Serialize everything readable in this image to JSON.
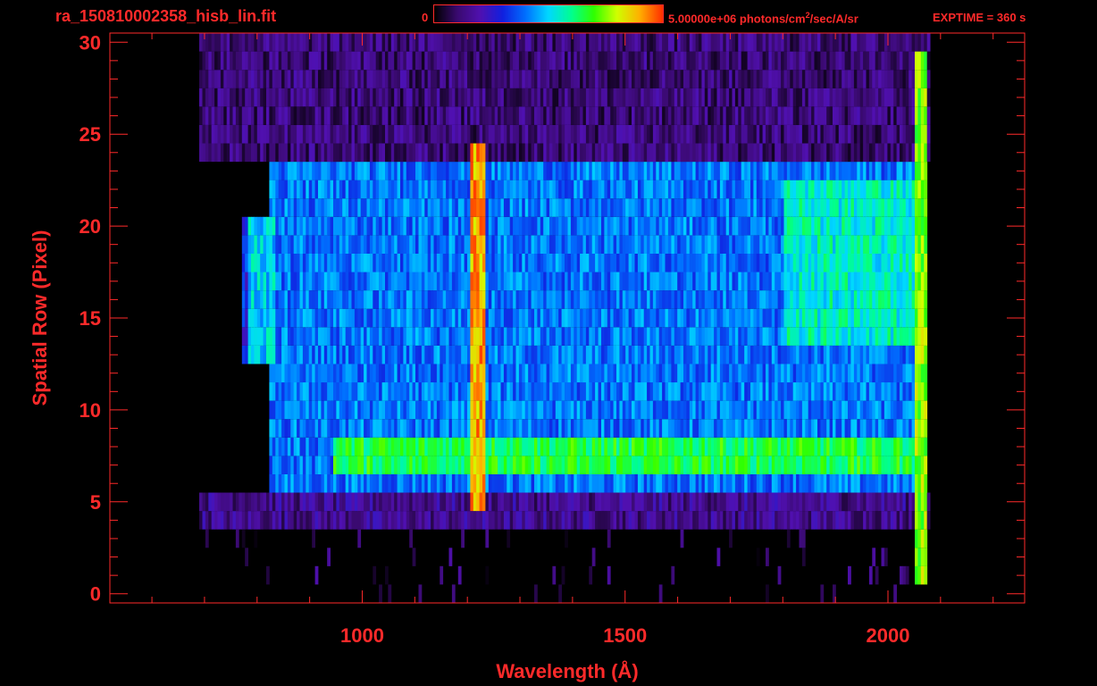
{
  "header": {
    "file_name": "ra_150810002358_hisb_lin.fit",
    "colorbar_min": "0",
    "colorbar_max_value": "5.00000e+06",
    "colorbar_unit_prefix": "photons/cm",
    "colorbar_unit_exp": "2",
    "colorbar_unit_suffix": "/sec/A/sr",
    "exptime": "EXPTIME = 360 s"
  },
  "colors": {
    "axis": "#ff2a2a",
    "background": "#000000",
    "colormap": [
      "#000000",
      "#3a0a70",
      "#5010b0",
      "#1020e0",
      "#0070ff",
      "#00d8ff",
      "#00ff90",
      "#30ff00",
      "#d0ff00",
      "#ffb000",
      "#ff3000"
    ]
  },
  "chart_data": {
    "type": "heatmap",
    "title": "ra_150810002358_hisb_lin.fit",
    "xlabel": "Wavelength (Å)",
    "ylabel": "Spatial Row (Pixel)",
    "x_ticks": [
      "1000",
      "1500",
      "2000"
    ],
    "y_ticks": [
      "0",
      "5",
      "10",
      "15",
      "20",
      "25",
      "30"
    ],
    "xlim": [
      520,
      2260
    ],
    "ylim": [
      -0.5,
      30.5
    ],
    "grid": false,
    "colorbar": {
      "min": 0,
      "max": 5000000,
      "units": "photons/cm^2/sec/A/sr"
    },
    "wavelength_coverage": [
      690,
      2080
    ],
    "features": [
      {
        "name": "Lyman-alpha emission line",
        "wavelength": 1216,
        "rows": [
          5,
          24
        ],
        "intensity": 0.9
      },
      {
        "name": "slit-edge bright band",
        "wavelength_range": [
          940,
          2060
        ],
        "rows": [
          7,
          8
        ],
        "intensity": 0.65
      },
      {
        "name": "long-wavelength band",
        "wavelength_range": [
          1800,
          2060
        ],
        "rows": [
          14,
          22
        ],
        "intensity": 0.55
      },
      {
        "name": "short-wavelength loop",
        "wavelength_range": [
          780,
          830
        ],
        "rows": [
          13,
          20
        ],
        "intensity": 0.5
      },
      {
        "name": "edge spike",
        "wavelength": 2060,
        "rows": [
          1,
          29
        ],
        "intensity": 0.75
      }
    ],
    "illuminated_rows": [
      {
        "rows": [
          6,
          23
        ],
        "wavelength_range": [
          820,
          2060
        ],
        "intensity": 0.4
      },
      {
        "rows": [
          13,
          20
        ],
        "wavelength_range": [
          770,
          820
        ],
        "intensity": 0.3
      },
      {
        "rows": [
          24,
          30
        ],
        "wavelength_range": [
          690,
          2080
        ],
        "intensity": 0.12
      },
      {
        "rows": [
          4,
          5
        ],
        "wavelength_range": [
          690,
          2080
        ],
        "intensity": 0.15
      }
    ]
  }
}
